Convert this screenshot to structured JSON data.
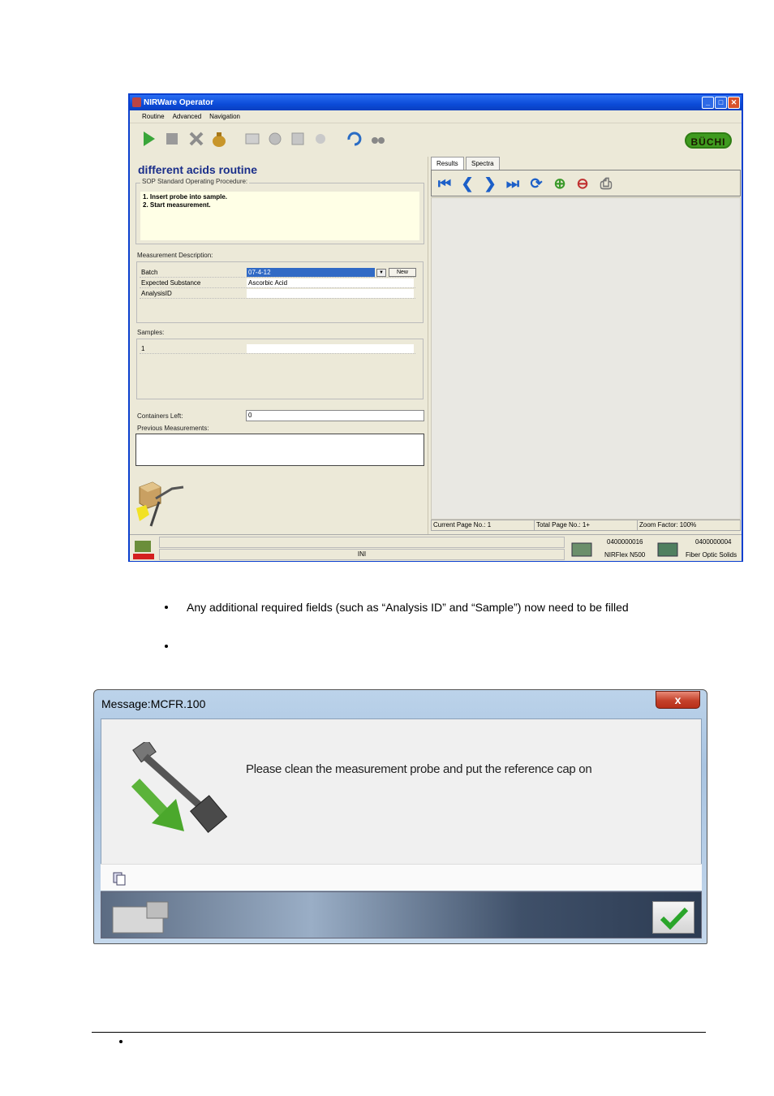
{
  "window1": {
    "title": "NIRWare Operator",
    "menu": [
      "Routine",
      "Advanced",
      "Navigation"
    ],
    "brand_logo": "BÜCHI",
    "routine_title": "different acids routine",
    "sop_label": "SOP Standard Operating Procedure:",
    "sop_text": "1. Insert probe into sample.\n2. Start measurement.",
    "measurement_description_label": "Measurement Description:",
    "fields": [
      {
        "key": "Batch",
        "value": "07-4-12"
      },
      {
        "key": "Expected Substance",
        "value": "Ascorbic Acid"
      },
      {
        "key": "AnalysisID",
        "value": ""
      }
    ],
    "new_button": "New",
    "samples_label": "Samples:",
    "samples": [
      {
        "key": "1",
        "value": ""
      }
    ],
    "containers_left_label": "Containers Left:",
    "containers_left_value": "0",
    "previous_measurements_label": "Previous Measurements:",
    "tabs": [
      "Results",
      "Spectra"
    ],
    "status": {
      "current_page": "Current Page No.: 1",
      "total_page": "Total Page No.: 1+",
      "zoom": "Zoom Factor: 100%"
    },
    "bottom_status": {
      "center": "INI",
      "device1_id": "0400000016",
      "device1_name": "NIRFlex N500",
      "device2_id": "0400000004",
      "device2_name": "Fiber Optic Solids"
    }
  },
  "bullets": [
    "Any additional required fields (such as “Analysis ID” and “Sample”) now need to be filled",
    "",
    ""
  ],
  "window2": {
    "title": "Message:MCFR.100",
    "close_label": "x",
    "message": "Please clean the measurement probe and put the reference cap on"
  }
}
